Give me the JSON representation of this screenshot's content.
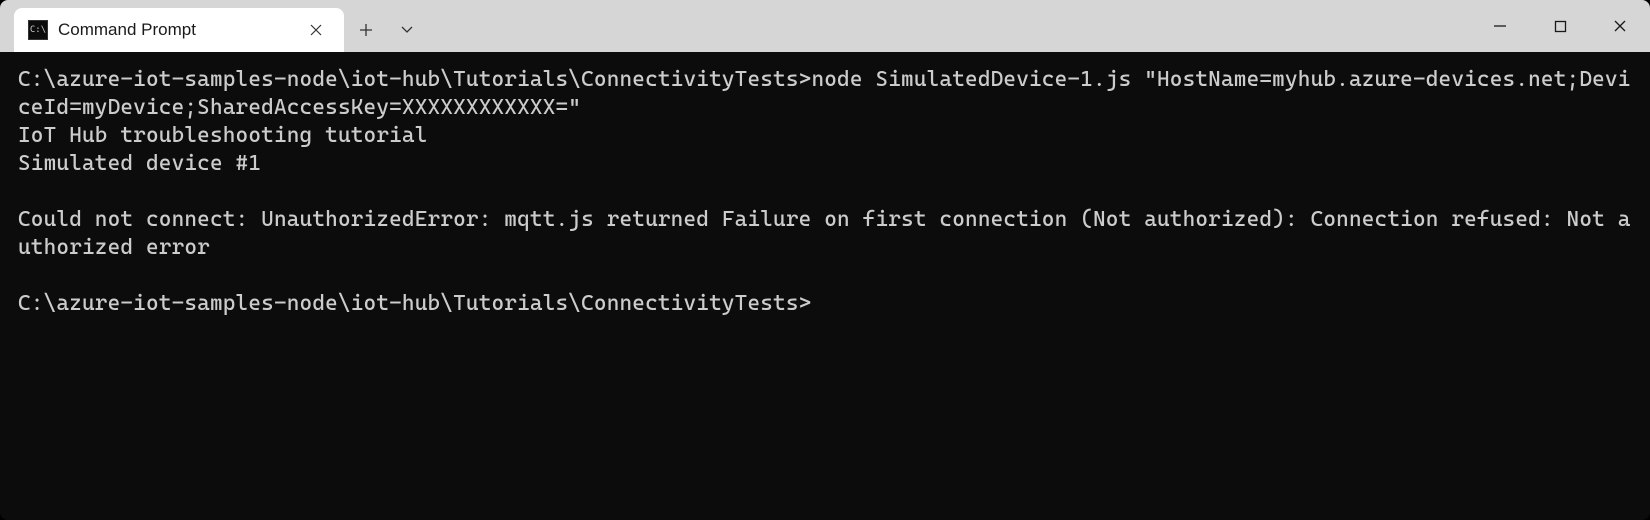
{
  "titlebar": {
    "tab_title": "Command Prompt"
  },
  "terminal": {
    "line1": "C:\\azure-iot-samples-node\\iot-hub\\Tutorials\\ConnectivityTests>node SimulatedDevice-1.js \"HostName=myhub.azure-devices.net;DeviceId=myDevice;SharedAccessKey=XXXXXXXXXXXX=\"",
    "line2": "IoT Hub troubleshooting tutorial",
    "line3": "Simulated device #1",
    "line4": "",
    "line5": "Could not connect: UnauthorizedError: mqtt.js returned Failure on first connection (Not authorized): Connection refused: Not authorized error",
    "line6": "",
    "line7": "C:\\azure-iot-samples-node\\iot-hub\\Tutorials\\ConnectivityTests>"
  }
}
